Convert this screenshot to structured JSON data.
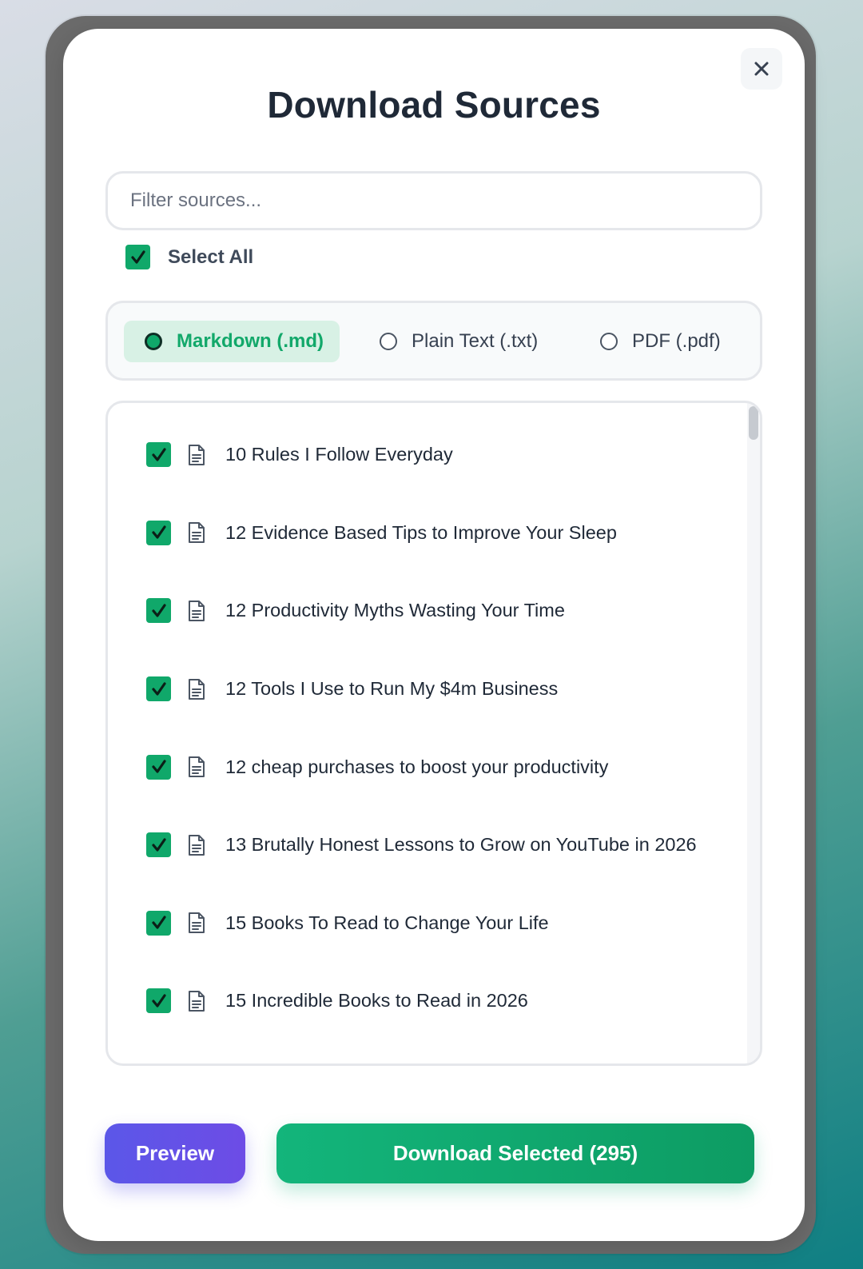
{
  "dialog": {
    "title": "Download Sources",
    "close_label": "×"
  },
  "filter": {
    "placeholder": "Filter sources...",
    "value": ""
  },
  "select_all": {
    "label": "Select All",
    "checked": true
  },
  "formats": [
    {
      "label": "Markdown (.md)",
      "selected": true
    },
    {
      "label": "Plain Text (.txt)",
      "selected": false
    },
    {
      "label": "PDF (.pdf)",
      "selected": false
    }
  ],
  "sources": [
    {
      "label": "10 Rules I Follow Everyday",
      "checked": true,
      "icon": "document-icon"
    },
    {
      "label": "12 Evidence Based Tips to Improve Your Sleep",
      "checked": true,
      "icon": "document-icon"
    },
    {
      "label": "12 Productivity Myths Wasting Your Time",
      "checked": true,
      "icon": "document-icon"
    },
    {
      "label": "12 Tools I Use to Run My $4m Business",
      "checked": true,
      "icon": "document-icon"
    },
    {
      "label": "12 cheap purchases to boost your productivity",
      "checked": true,
      "icon": "document-icon"
    },
    {
      "label": "13 Brutally Honest Lessons to Grow on YouTube in 2026",
      "checked": true,
      "icon": "document-icon"
    },
    {
      "label": "15 Books To Read to Change Your Life",
      "checked": true,
      "icon": "document-icon"
    },
    {
      "label": "15 Incredible Books to Read in 2026",
      "checked": true,
      "icon": "document-icon"
    }
  ],
  "actions": {
    "preview_label": "Preview",
    "download_label": "Download Selected (295)"
  },
  "colors": {
    "accent_green": "#10a86a",
    "preview_purple": "#5b57e8",
    "title_text": "#1f2937"
  }
}
